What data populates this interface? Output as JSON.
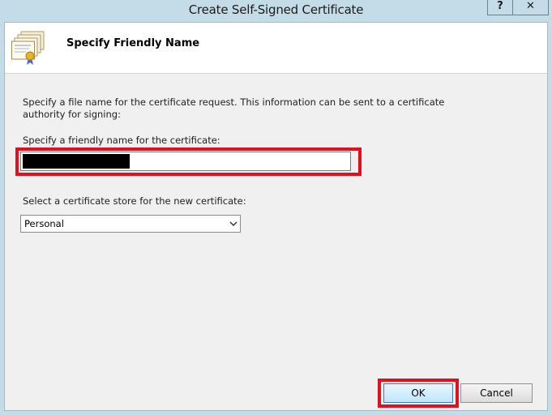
{
  "window": {
    "title": "Create Self-Signed Certificate",
    "help_label": "?",
    "close_label": "✕"
  },
  "header": {
    "title": "Specify Friendly Name",
    "icon": "certificate-icon"
  },
  "form": {
    "description": "Specify a file name for the certificate request.  This information can be sent to a certificate authority for signing:",
    "friendly_name_label": "Specify a friendly name for the certificate:",
    "friendly_name_value": "",
    "store_label": "Select a certificate store for the new certificate:",
    "store_selected": "Personal"
  },
  "buttons": {
    "ok": "OK",
    "cancel": "Cancel"
  },
  "colors": {
    "highlight": "#e0101f",
    "titlebar": "#c4dce8",
    "panel": "#f0f0f0"
  }
}
